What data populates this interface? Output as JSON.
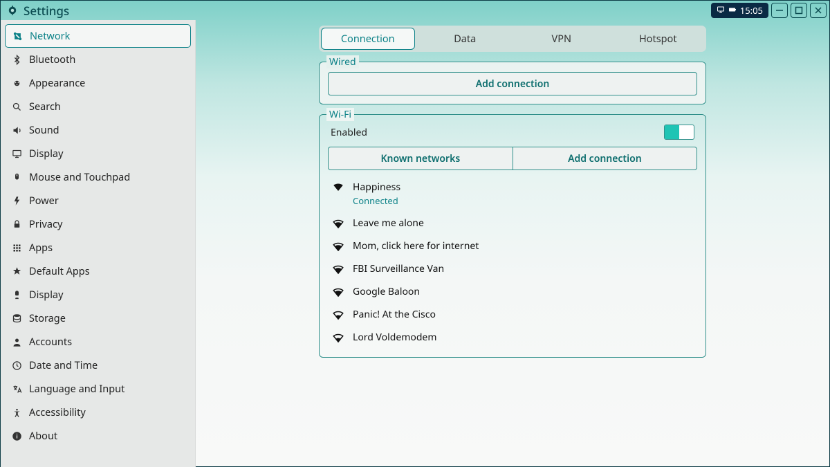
{
  "titlebar": {
    "app_title": "Settings",
    "tray_time": "15:05"
  },
  "sidebar": {
    "items": [
      {
        "label": "Network"
      },
      {
        "label": "Bluetooth"
      },
      {
        "label": "Appearance"
      },
      {
        "label": "Search"
      },
      {
        "label": "Sound"
      },
      {
        "label": "Display"
      },
      {
        "label": "Mouse and Touchpad"
      },
      {
        "label": "Power"
      },
      {
        "label": "Privacy"
      },
      {
        "label": "Apps"
      },
      {
        "label": "Default Apps"
      },
      {
        "label": "Display"
      },
      {
        "label": "Storage"
      },
      {
        "label": "Accounts"
      },
      {
        "label": "Date and Time"
      },
      {
        "label": "Language and Input"
      },
      {
        "label": "Accessibility"
      },
      {
        "label": "About"
      }
    ]
  },
  "tabs": [
    "Connection",
    "Data",
    "VPN",
    "Hotspot"
  ],
  "wired": {
    "legend": "Wired",
    "add_label": "Add connection"
  },
  "wifi": {
    "legend": "Wi-Fi",
    "enabled_label": "Enabled",
    "known_label": "Known networks",
    "add_label": "Add connection",
    "networks": [
      {
        "name": "Happiness",
        "status": "Connected"
      },
      {
        "name": "Leave me alone"
      },
      {
        "name": "Mom, click here for internet"
      },
      {
        "name": "FBI Surveillance Van"
      },
      {
        "name": "Google Baloon"
      },
      {
        "name": "Panic! At the Cisco"
      },
      {
        "name": "Lord Voldemodem"
      }
    ]
  }
}
